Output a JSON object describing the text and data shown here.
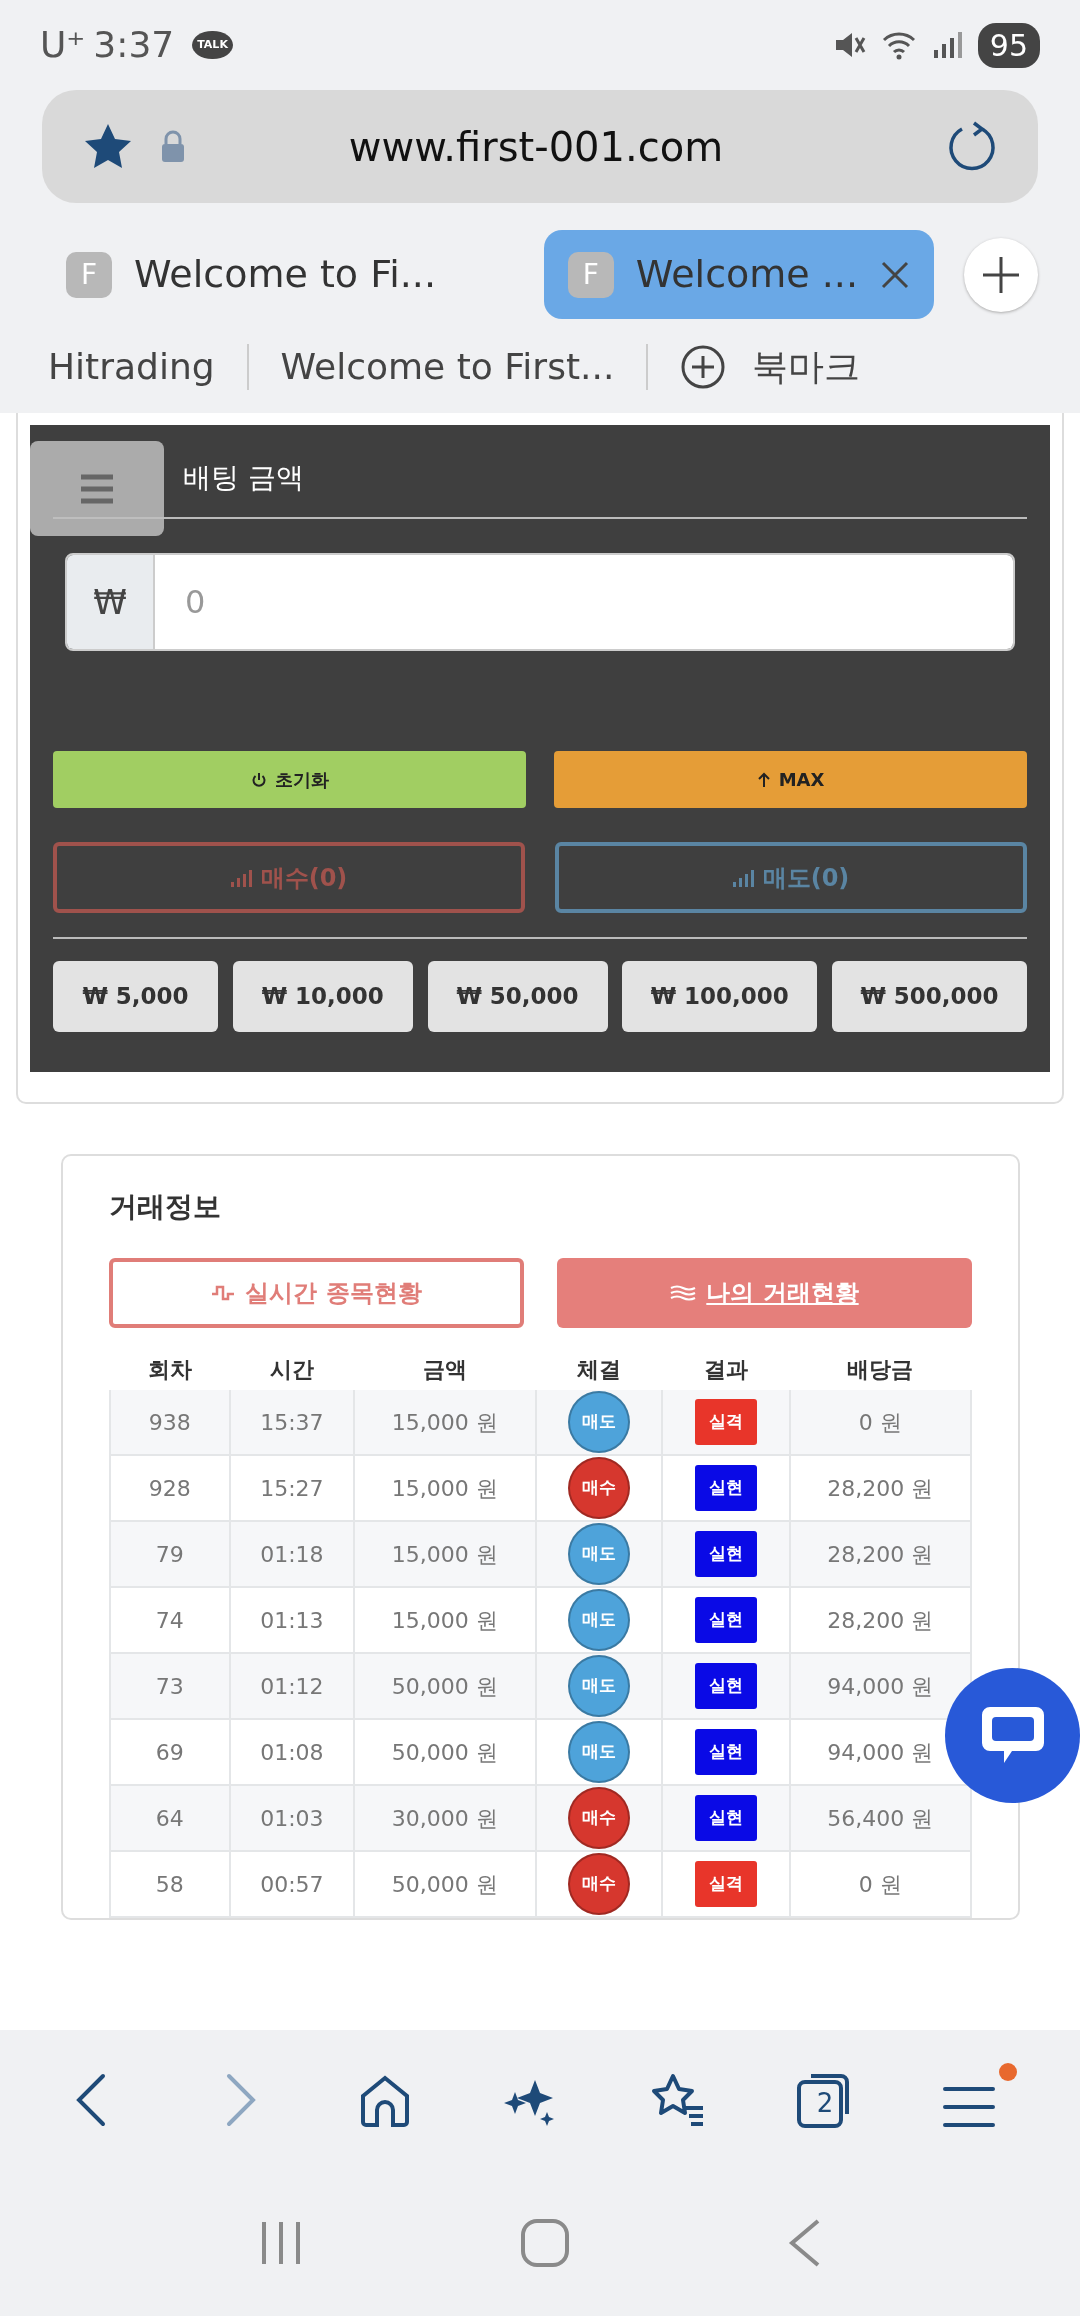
{
  "status_bar": {
    "carrier": "U⁺",
    "time": "3:37",
    "talk": "TALK",
    "battery": "95"
  },
  "browser": {
    "url": "www.first-001.com",
    "tabs": [
      {
        "favicon": "F",
        "title": "Welcome to Fi...",
        "selected": false
      },
      {
        "favicon": "F",
        "title": "Welcome ...",
        "selected": true
      }
    ],
    "bookmarks": [
      "Hitrading",
      "Welcome to First..."
    ],
    "bookmark_add": "북마크"
  },
  "bet_panel": {
    "title": "배팅 금액",
    "currency": "₩",
    "amount_placeholder": "0",
    "reset": "초기화",
    "max": "MAX",
    "buy": "매수(0)",
    "sell": "매도(0)",
    "presets": [
      "₩ 5,000",
      "₩ 10,000",
      "₩ 50,000",
      "₩ 100,000",
      "₩ 500,000"
    ]
  },
  "trade_info": {
    "title": "거래정보",
    "tabs": [
      {
        "label": "실시간 종목현황",
        "selected": false
      },
      {
        "label": "나의 거래현황",
        "selected": true
      }
    ],
    "table": {
      "columns": [
        "회차",
        "시간",
        "금액",
        "체결",
        "결과",
        "배당금"
      ],
      "rows": [
        {
          "round": "938",
          "time": "15:37",
          "amount": "15,000 원",
          "side": {
            "text": "매도",
            "color": "#4ea3da"
          },
          "result": {
            "text": "실격",
            "color": "#e8352a"
          },
          "payout": "0 원"
        },
        {
          "round": "928",
          "time": "15:27",
          "amount": "15,000 원",
          "side": {
            "text": "매수",
            "color": "#d6372e"
          },
          "result": {
            "text": "실현",
            "color": "#0a0ae6"
          },
          "payout": "28,200 원"
        },
        {
          "round": "79",
          "time": "01:18",
          "amount": "15,000 원",
          "side": {
            "text": "매도",
            "color": "#4ea3da"
          },
          "result": {
            "text": "실현",
            "color": "#0a0ae6"
          },
          "payout": "28,200 원"
        },
        {
          "round": "74",
          "time": "01:13",
          "amount": "15,000 원",
          "side": {
            "text": "매도",
            "color": "#4ea3da"
          },
          "result": {
            "text": "실현",
            "color": "#0a0ae6"
          },
          "payout": "28,200 원"
        },
        {
          "round": "73",
          "time": "01:12",
          "amount": "50,000 원",
          "side": {
            "text": "매도",
            "color": "#4ea3da"
          },
          "result": {
            "text": "실현",
            "color": "#0a0ae6"
          },
          "payout": "94,000 원"
        },
        {
          "round": "69",
          "time": "01:08",
          "amount": "50,000 원",
          "side": {
            "text": "매도",
            "color": "#4ea3da"
          },
          "result": {
            "text": "실현",
            "color": "#0a0ae6"
          },
          "payout": "94,000 원"
        },
        {
          "round": "64",
          "time": "01:03",
          "amount": "30,000 원",
          "side": {
            "text": "매수",
            "color": "#d6372e"
          },
          "result": {
            "text": "실현",
            "color": "#0a0ae6"
          },
          "payout": "56,400 원"
        },
        {
          "round": "58",
          "time": "00:57",
          "amount": "50,000 원",
          "side": {
            "text": "매수",
            "color": "#d6372e"
          },
          "result": {
            "text": "실격",
            "color": "#e8352a"
          },
          "payout": "0 원"
        }
      ]
    }
  },
  "toolbar": {
    "tab_count": "2",
    "menu_badge": true
  }
}
